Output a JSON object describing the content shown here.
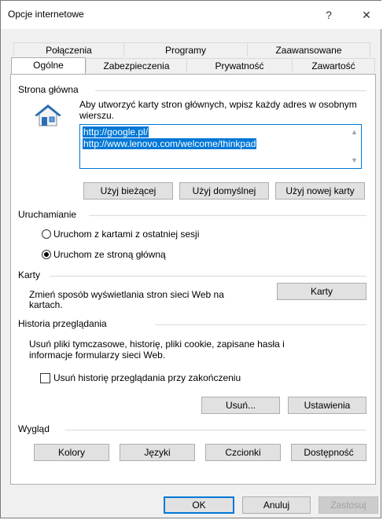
{
  "window": {
    "title": "Opcje internetowe",
    "help_glyph": "?",
    "close_glyph": "✕"
  },
  "tabs": {
    "row1": [
      "Połączenia",
      "Programy",
      "Zaawansowane"
    ],
    "row2": [
      "Ogólne",
      "Zabezpieczenia",
      "Prywatność",
      "Zawartość"
    ],
    "active": "Ogólne"
  },
  "home_page": {
    "group_label": "Strona główna",
    "hint": "Aby utworzyć karty stron głównych, wpisz każdy adres w osobnym wierszu.",
    "urls": [
      "http://google.pl/",
      "http://www.lenovo.com/welcome/thinkpad"
    ],
    "use_current_label": "Użyj bieżącej",
    "use_default_label": "Użyj domyślnej",
    "use_new_tab_label": "Użyj nowej karty"
  },
  "startup": {
    "group_label": "Uruchamianie",
    "option_last_session": "Uruchom z kartami z ostatniej sesji",
    "option_home_page": "Uruchom ze stroną główną",
    "selected": "Uruchom ze stroną główną"
  },
  "tabs_group": {
    "group_label": "Karty",
    "description": "Zmień sposób wyświetlania stron sieci Web na kartach.",
    "button_label": "Karty"
  },
  "history": {
    "group_label": "Historia przeglądania",
    "description": "Usuń pliki tymczasowe, historię, pliki cookie, zapisane hasła i informacje formularzy sieci Web.",
    "checkbox_label": "Usuń historię przeglądania przy zakończeniu",
    "checkbox_checked": false,
    "delete_label": "Usuń...",
    "settings_label": "Ustawienia"
  },
  "appearance": {
    "group_label": "Wygląd",
    "colors_label": "Kolory",
    "languages_label": "Języki",
    "fonts_label": "Czcionki",
    "accessibility_label": "Dostępność"
  },
  "footer": {
    "ok_label": "OK",
    "cancel_label": "Anuluj",
    "apply_label": "Zastosuj"
  },
  "colors": {
    "accent": "#0078d7",
    "button_bg": "#e1e1e1",
    "dialog_bg": "#f0f0f0"
  }
}
